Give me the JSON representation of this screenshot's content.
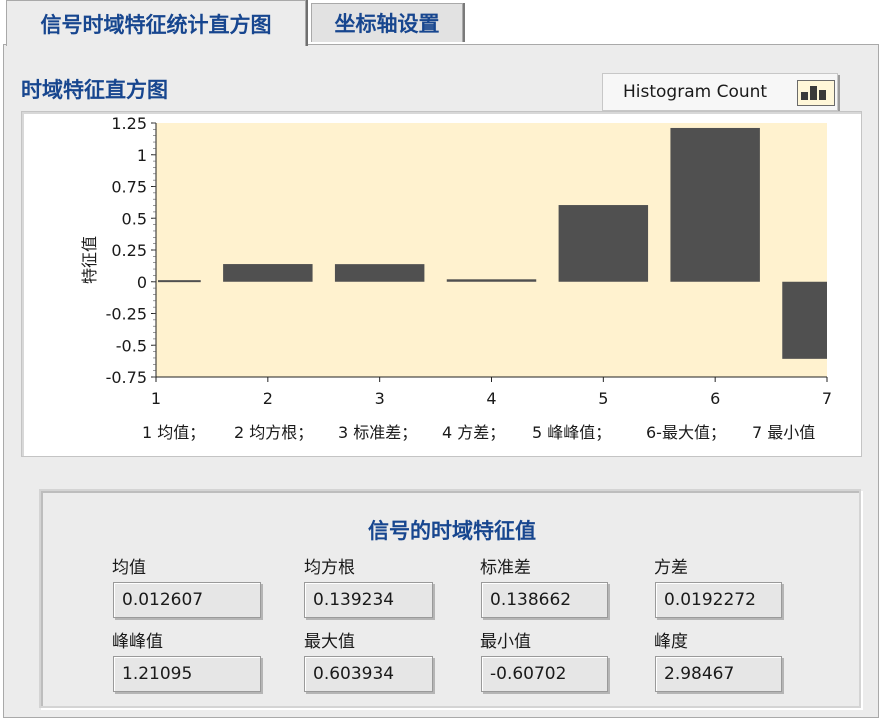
{
  "tabs": [
    {
      "label": "信号时域特征统计直方图",
      "active": true
    },
    {
      "label": "坐标轴设置",
      "active": false
    }
  ],
  "graph": {
    "title": "时域特征直方图",
    "legend_label": "Histogram Count",
    "category_caption": [
      "1 均值；",
      "2 均方根；",
      "3 标准差；",
      "4 方差；",
      "5 峰峰值；",
      "6-最大值；",
      "7 最小值"
    ]
  },
  "chart_data": {
    "type": "bar",
    "x": [
      1,
      2,
      3,
      4,
      5,
      6,
      7
    ],
    "values": [
      0.012607,
      0.139234,
      0.138662,
      0.0192272,
      0.603934,
      1.21095,
      -0.60702
    ],
    "xticks": [
      "1",
      "2",
      "3",
      "4",
      "5",
      "6",
      "7"
    ],
    "yticks": [
      "1.25",
      "1",
      "0.75",
      "0.5",
      "0.25",
      "0",
      "-0.25",
      "-0.5",
      "-0.75"
    ],
    "ylabel": "特征值",
    "xlabel": "",
    "ylim": [
      -0.75,
      1.25
    ],
    "xlim": [
      1,
      7
    ],
    "grid": false,
    "plot_bg": "#fff2cf",
    "bar_color": "#505050"
  },
  "stats": {
    "title": "信号的时域特征值",
    "fields": [
      {
        "label": "均值",
        "value": "0.012607"
      },
      {
        "label": "均方根",
        "value": "0.139234"
      },
      {
        "label": "标准差",
        "value": "0.138662"
      },
      {
        "label": "方差",
        "value": "0.0192272"
      },
      {
        "label": "峰峰值",
        "value": "1.21095"
      },
      {
        "label": "最大值",
        "value": "0.603934"
      },
      {
        "label": "最小值",
        "value": "-0.60702"
      },
      {
        "label": "峰度",
        "value": "2.98467"
      }
    ]
  },
  "colors": {
    "title_blue": "#17468f",
    "panel_bg": "#ececec"
  }
}
